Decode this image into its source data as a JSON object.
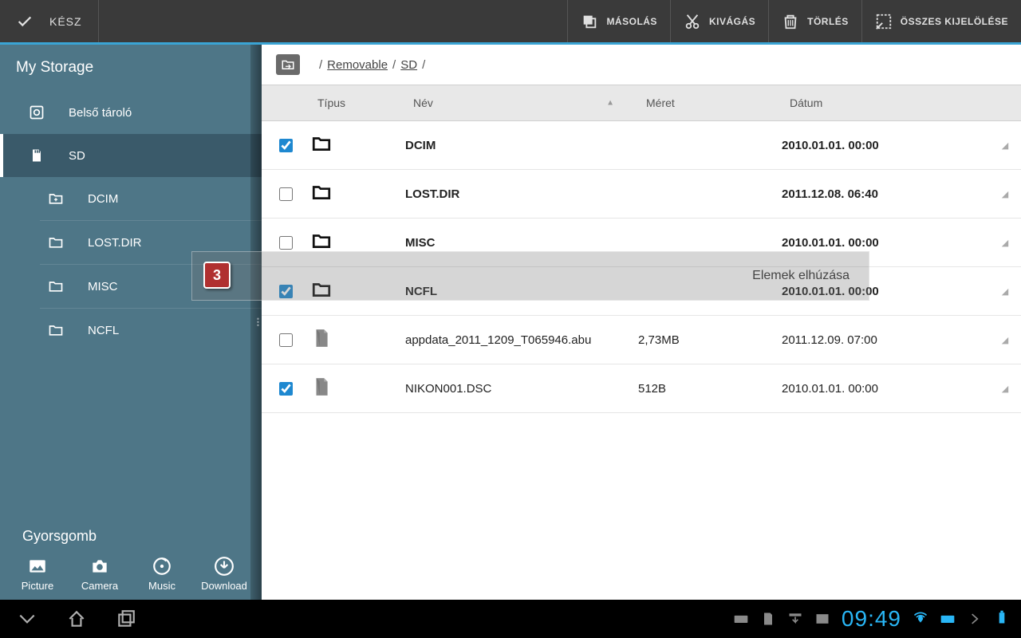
{
  "topbar": {
    "done": "KÉSZ",
    "actions": {
      "copy": "MÁSOLÁS",
      "cut": "KIVÁGÁS",
      "delete": "TÖRLÉS",
      "selectAll": "ÖSSZES KIJELÖLÉSE"
    }
  },
  "sidebar": {
    "title": "My Storage",
    "items": [
      {
        "label": "Belső tároló"
      },
      {
        "label": "SD"
      },
      {
        "label": "DCIM"
      },
      {
        "label": "LOST.DIR"
      },
      {
        "label": "MISC"
      },
      {
        "label": "NCFL"
      }
    ],
    "shortcutTitle": "Gyorsgomb",
    "shortcuts": {
      "picture": "Picture",
      "camera": "Camera",
      "music": "Music",
      "download": "Download"
    }
  },
  "breadcrumb": {
    "p1": "Removable",
    "p2": "SD"
  },
  "columns": {
    "type": "Típus",
    "name": "Név",
    "size": "Méret",
    "date": "Dátum"
  },
  "rows": [
    {
      "checked": true,
      "kind": "folder",
      "name": "DCIM",
      "size": "",
      "date": "2010.01.01. 00:00"
    },
    {
      "checked": false,
      "kind": "folder",
      "name": "LOST.DIR",
      "size": "",
      "date": "2011.12.08. 06:40"
    },
    {
      "checked": false,
      "kind": "folder",
      "name": "MISC",
      "size": "",
      "date": "2010.01.01. 00:00"
    },
    {
      "checked": true,
      "kind": "folder",
      "name": "NCFL",
      "size": "",
      "date": "2010.01.01. 00:00"
    },
    {
      "checked": false,
      "kind": "file",
      "name": "appdata_2011_1209_T065946.abu",
      "size": "2,73MB",
      "date": "2011.12.09. 07:00"
    },
    {
      "checked": true,
      "kind": "file",
      "name": "NIKON001.DSC",
      "size": "512B",
      "date": "2010.01.01. 00:00"
    }
  ],
  "drag": {
    "count": "3",
    "label": "Elemek elhúzása"
  },
  "navbar": {
    "clock": "09:49"
  }
}
